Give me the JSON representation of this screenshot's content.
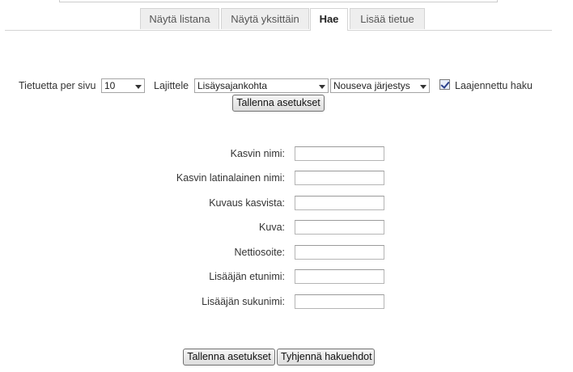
{
  "tabs": [
    {
      "label": "Näytä listana",
      "active": false
    },
    {
      "label": "Näytä yksittäin",
      "active": false
    },
    {
      "label": "Hae",
      "active": true
    },
    {
      "label": "Lisää tietue",
      "active": false
    }
  ],
  "settings": {
    "per_page_label": "Tietuetta per sivu",
    "per_page_value": "10",
    "sort_label": "Lajittele",
    "sort_field_value": "Lisäysajankohta",
    "sort_order_value": "Nouseva järjestys",
    "advanced_search_label": "Laajennettu haku",
    "advanced_search_checked": true,
    "save_settings_label": "Tallenna asetukset"
  },
  "search_fields": [
    {
      "label": "Kasvin nimi:",
      "value": ""
    },
    {
      "label": "Kasvin latinalainen nimi:",
      "value": ""
    },
    {
      "label": "Kuvaus kasvista:",
      "value": ""
    },
    {
      "label": "Kuva:",
      "value": ""
    },
    {
      "label": "Nettiosoite:",
      "value": ""
    },
    {
      "label": "Lisääjän etunimi:",
      "value": ""
    },
    {
      "label": "Lisääjän sukunimi:",
      "value": ""
    }
  ],
  "footer_buttons": {
    "save_label": "Tallenna asetukset",
    "clear_label": "Tyhjennä hakuehdot"
  }
}
